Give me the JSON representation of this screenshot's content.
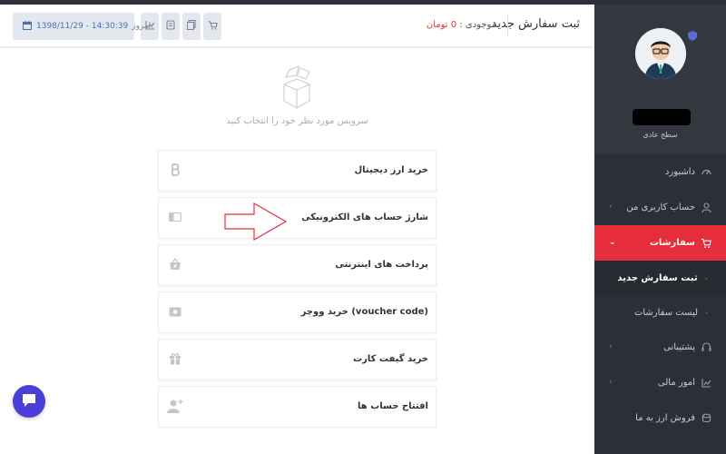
{
  "header": {
    "title": "ثبت سفارش جدید",
    "balance_label": "موجودی :",
    "balance_amount": "0 تومان",
    "date_label": "امروز:",
    "date_value": "1398/11/29 - 14:30:39"
  },
  "sidebar": {
    "user_level": "سطح عادی",
    "items": [
      {
        "label": "داشبورد",
        "icon": "speedometer-icon"
      },
      {
        "label": "حساب کاربری من",
        "icon": "user-icon",
        "has_children": true
      },
      {
        "label": "سفارشات",
        "icon": "cart-icon",
        "has_children": true,
        "active": true
      },
      {
        "label": "پشتیبانی",
        "icon": "headset-icon",
        "has_children": true
      },
      {
        "label": "امور مالی",
        "icon": "chart-icon",
        "has_children": true
      },
      {
        "label": "فروش ارز به ما",
        "icon": "coins-icon"
      }
    ],
    "orders_submenu": [
      {
        "label": "ثبت سفارش جدید",
        "current": true
      },
      {
        "label": "لیست سفارشات",
        "current": false
      }
    ]
  },
  "main": {
    "empty_text": "سرویس مورد نظر خود را انتخاب کنید",
    "services": [
      {
        "label": "خرید ارز دیجیتال",
        "icon": "bitcoin-icon"
      },
      {
        "label": "شارژ حساب های الکترونیکی",
        "icon": "wallet-icon"
      },
      {
        "label": "پرداخت های اینترنتی",
        "icon": "basket-icon"
      },
      {
        "label": "خرید ووچر (voucher code)",
        "icon": "voucher-icon"
      },
      {
        "label": "خرید گیفت کارت",
        "icon": "gift-icon"
      },
      {
        "label": "افتتاح حساب ها",
        "icon": "user-add-icon"
      }
    ]
  },
  "colors": {
    "accent": "#e52d3c",
    "sidebar_bg": "#2b2f37",
    "chat": "#4b3fd6"
  }
}
